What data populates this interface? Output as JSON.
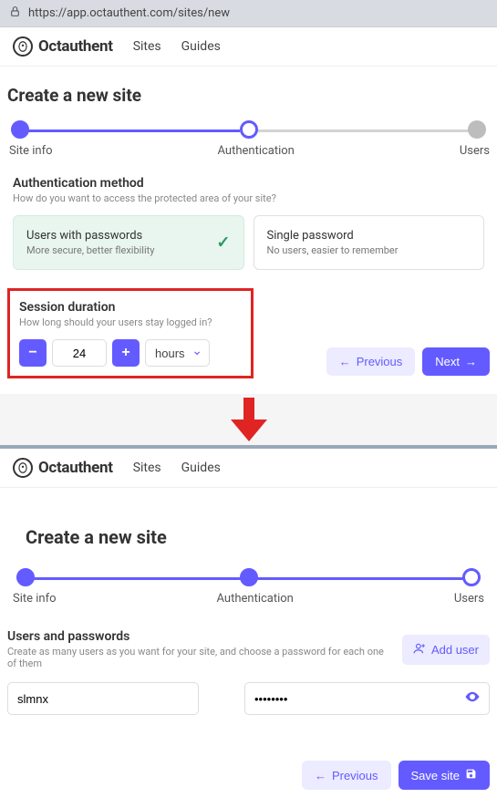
{
  "browser": {
    "url": "https://app.octauthent.com/sites/new"
  },
  "brand": {
    "name": "Octauthent"
  },
  "nav": {
    "sites": "Sites",
    "guides": "Guides"
  },
  "panel1": {
    "title": "Create a new site",
    "steps": {
      "info": "Site info",
      "auth": "Authentication",
      "users": "Users"
    },
    "auth_method": {
      "heading": "Authentication method",
      "desc": "How do you want to access the protected area of your site?",
      "card1_title": "Users with passwords",
      "card1_sub": "More secure, better flexibility",
      "card2_title": "Single password",
      "card2_sub": "No users, easier to remember"
    },
    "session": {
      "heading": "Session duration",
      "desc": "How long should your users stay logged in?",
      "value": "24",
      "unit": "hours"
    },
    "buttons": {
      "prev": "Previous",
      "next": "Next"
    }
  },
  "panel2": {
    "title": "Create a new site",
    "steps": {
      "info": "Site info",
      "auth": "Authentication",
      "users": "Users"
    },
    "users": {
      "heading": "Users and passwords",
      "desc": "Create as many users as you want for your site, and choose a password for each one of them",
      "add_label": "Add user",
      "username": "slmnx",
      "password_mask": "••••••••"
    },
    "buttons": {
      "prev": "Previous",
      "save": "Save site"
    }
  }
}
